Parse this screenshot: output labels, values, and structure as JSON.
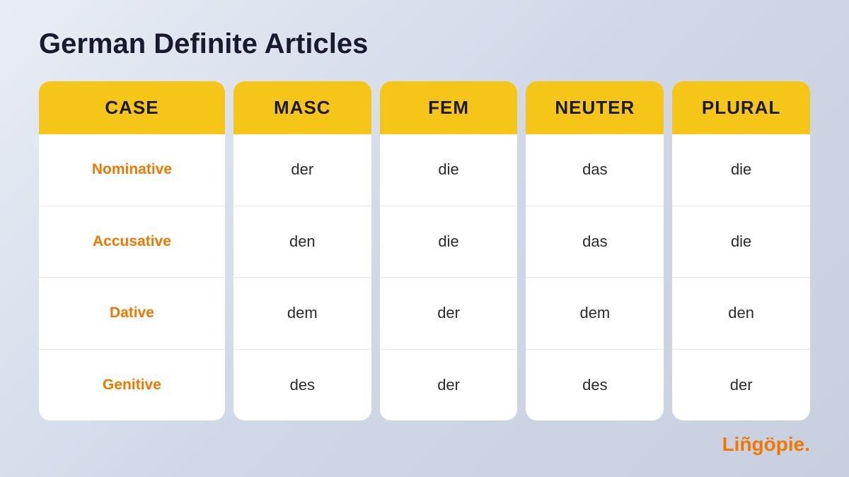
{
  "page": {
    "title": "German Definite Articles"
  },
  "columns": [
    {
      "id": "case",
      "header": "CASE",
      "is_case_col": true,
      "cells": [
        "Nominative",
        "Accusative",
        "Dative",
        "Genitive"
      ]
    },
    {
      "id": "masc",
      "header": "MASC",
      "is_case_col": false,
      "cells": [
        "der",
        "den",
        "dem",
        "des"
      ]
    },
    {
      "id": "fem",
      "header": "FEM",
      "is_case_col": false,
      "cells": [
        "die",
        "die",
        "der",
        "der"
      ]
    },
    {
      "id": "neuter",
      "header": "NEUTER",
      "is_case_col": false,
      "cells": [
        "das",
        "das",
        "dem",
        "des"
      ]
    },
    {
      "id": "plural",
      "header": "PLURAL",
      "is_case_col": false,
      "cells": [
        "die",
        "die",
        "den",
        "der"
      ]
    }
  ],
  "logo": {
    "text": "Liñgöpie."
  }
}
